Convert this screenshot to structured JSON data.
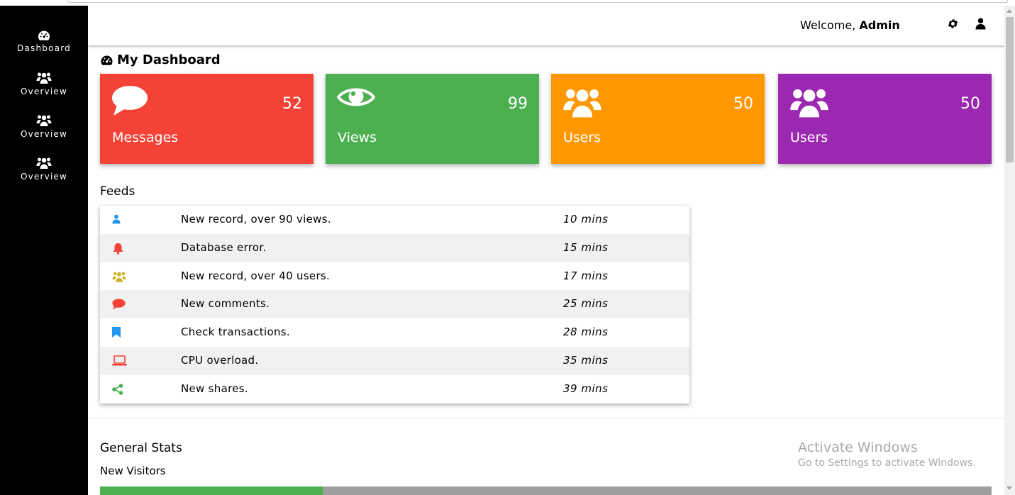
{
  "sidebar": {
    "items": [
      {
        "label": "Dashboard",
        "icon": "dashboard-icon"
      },
      {
        "label": "Overview",
        "icon": "users-icon"
      },
      {
        "label": "Overview",
        "icon": "users-icon"
      },
      {
        "label": "Overview",
        "icon": "users-icon"
      }
    ]
  },
  "header": {
    "welcome_prefix": "Welcome, ",
    "username": "Admin"
  },
  "dashboard": {
    "title": "My Dashboard"
  },
  "cards": [
    {
      "label": "Messages",
      "value": "52",
      "icon": "comment-icon",
      "color": "#f44336"
    },
    {
      "label": "Views",
      "value": "99",
      "icon": "eye-icon",
      "color": "#4caf50"
    },
    {
      "label": "Users",
      "value": "50",
      "icon": "users-icon",
      "color": "#ff9800"
    },
    {
      "label": "Users",
      "value": "50",
      "icon": "users-icon",
      "color": "#9c27b0"
    }
  ],
  "feeds": {
    "title": "Feeds",
    "items": [
      {
        "icon": "user-icon",
        "color": "#2196f3",
        "text": "New record, over 90 views.",
        "time": "10 mins"
      },
      {
        "icon": "bell-icon",
        "color": "#f44336",
        "text": "Database error.",
        "time": "15 mins"
      },
      {
        "icon": "users-icon",
        "color": "#cdb32c",
        "text": "New record, over 40 users.",
        "time": "17 mins"
      },
      {
        "icon": "comment-icon",
        "color": "#f44336",
        "text": "New comments.",
        "time": "25 mins"
      },
      {
        "icon": "bookmark-icon",
        "color": "#2196f3",
        "text": "Check transactions.",
        "time": "28 mins"
      },
      {
        "icon": "laptop-icon",
        "color": "#f44336",
        "text": "CPU overload.",
        "time": "35 mins"
      },
      {
        "icon": "share-icon",
        "color": "#4caf50",
        "text": "New shares.",
        "time": "39 mins"
      }
    ]
  },
  "stats": {
    "title": "General Stats",
    "new_visitors_label": "New Visitors",
    "new_visitors_progress": 0.25
  },
  "watermark": {
    "line1": "Activate Windows",
    "line2": "Go to Settings to activate Windows."
  }
}
